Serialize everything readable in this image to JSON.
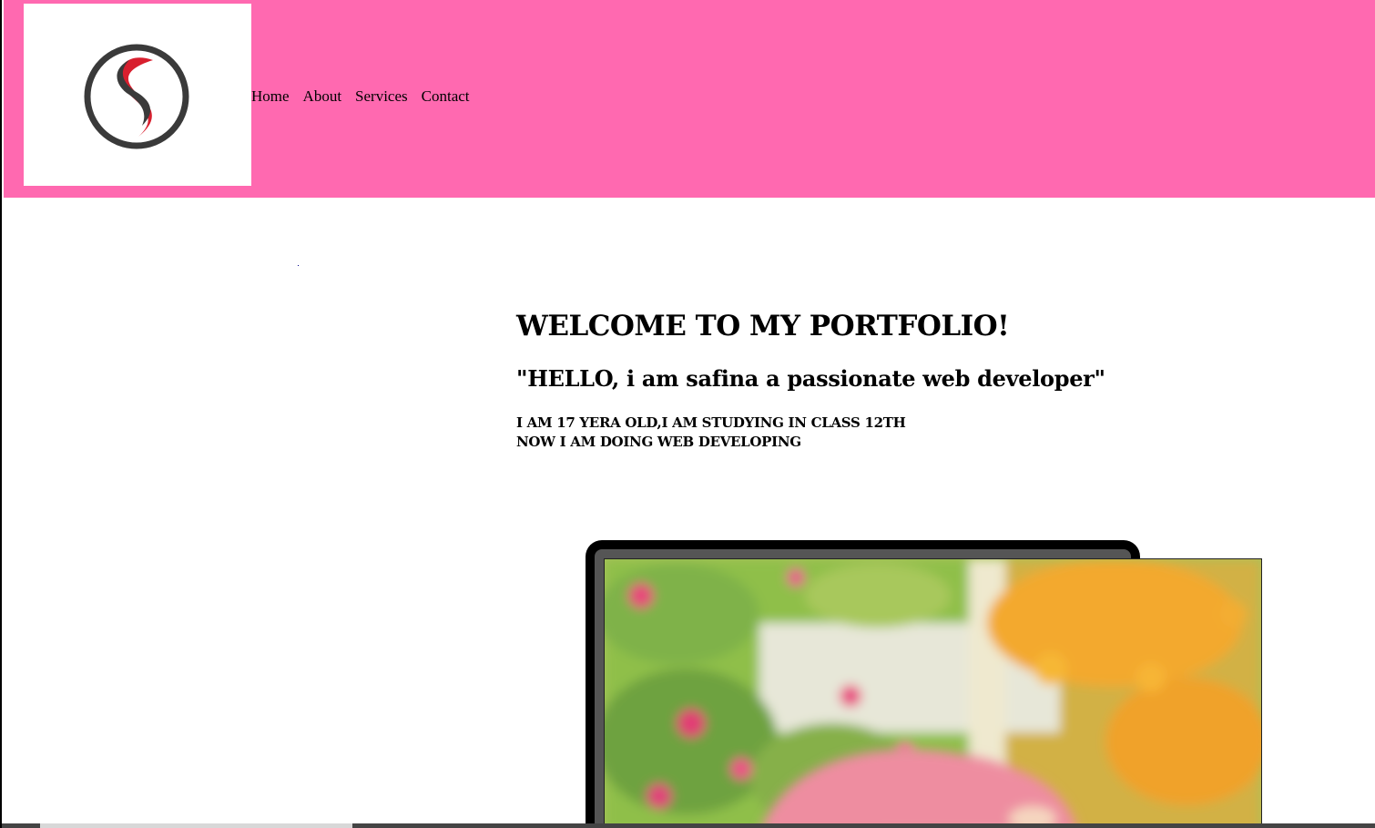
{
  "header": {
    "background_color": "#ff69b0",
    "logo": {
      "icon": "s-logo-icon",
      "letter": "S"
    },
    "nav": [
      "Home",
      "About",
      "Services",
      "Contact"
    ]
  },
  "hero": {
    "title": "WELCOME TO MY PORTFOLIO!",
    "subtitle": "\"HELLO, i am safina a passionate web developer\"",
    "bio_line1": "I AM 17 YERA OLD,I AM STUDYING IN CLASS 12TH",
    "bio_line2": "NOW I AM DOING WEB DEVELOPING"
  },
  "media": {
    "laptop_frame": "laptop-icon",
    "photo": "profile-photo"
  }
}
